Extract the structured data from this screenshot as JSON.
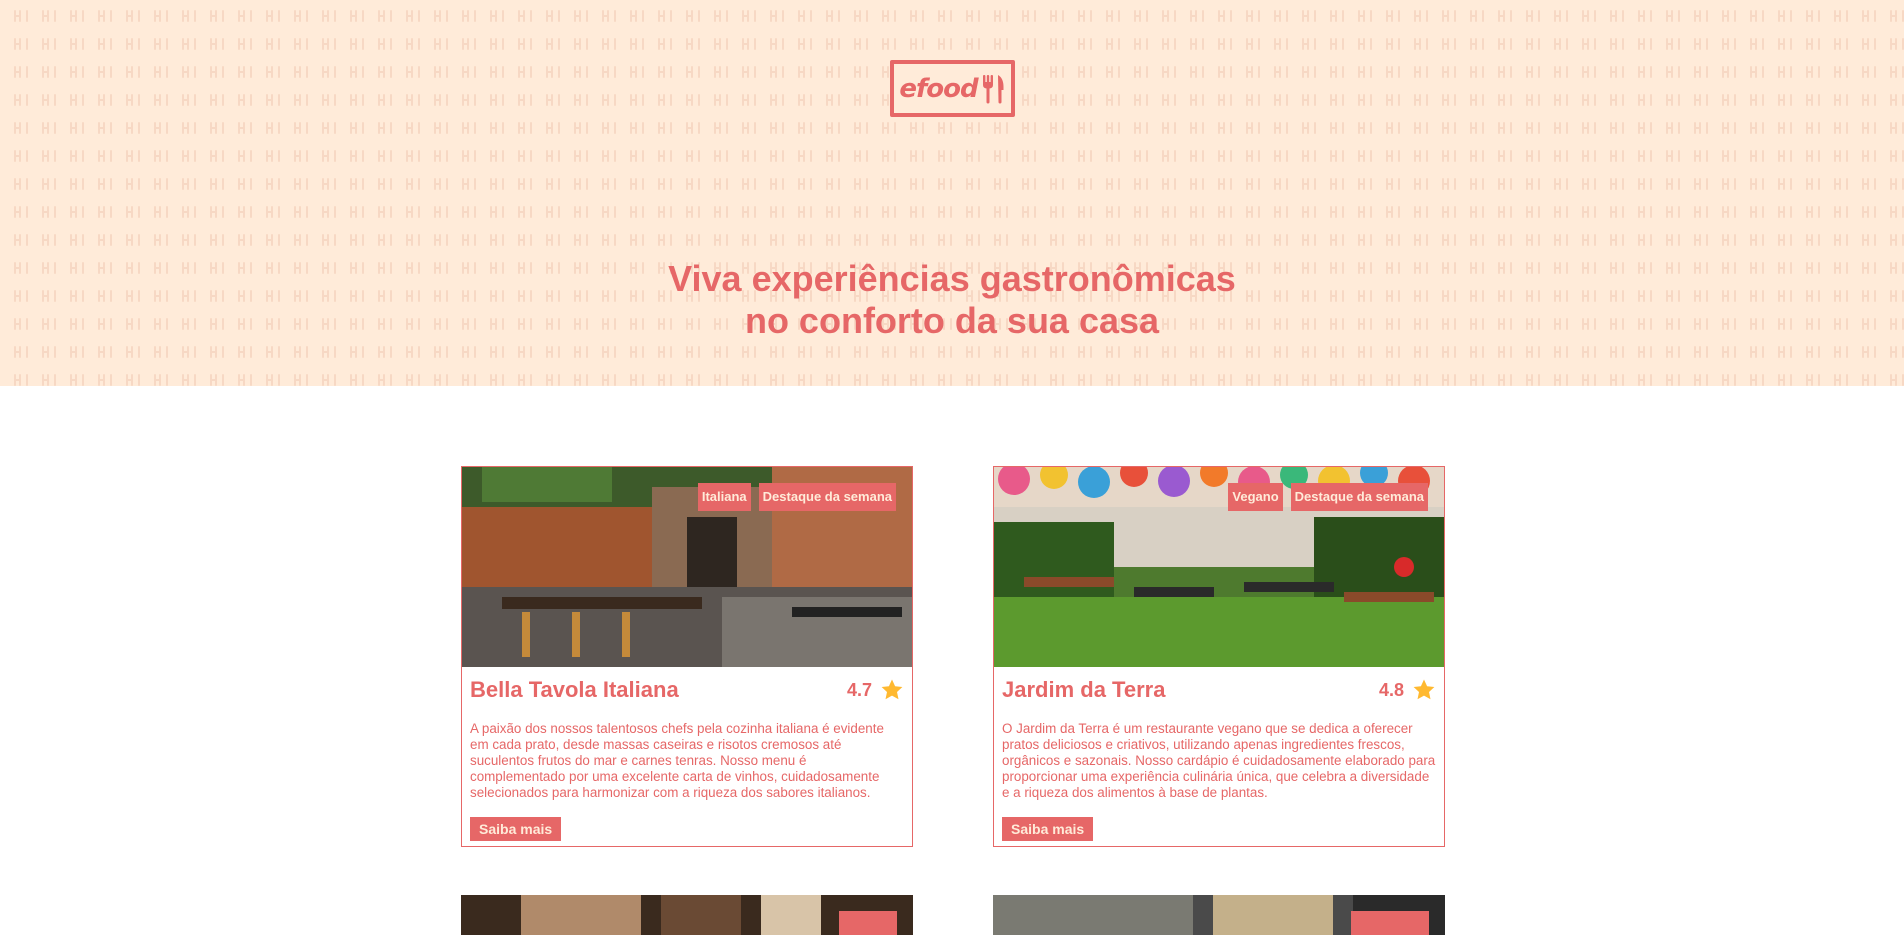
{
  "header": {
    "logo_text": "efood",
    "logo_icon": "fork-knife-icon",
    "pattern_icon": "fork-knife-icon",
    "title_line1": "Viva experiências gastronômicas",
    "title_line2": "no conforto da sua casa"
  },
  "colors": {
    "primary": "#e66767",
    "background_light": "#ffebd9",
    "white": "#ffffff",
    "star": "#ffb930"
  },
  "restaurants": [
    {
      "name": "Bella Tavola Italiana",
      "rating": "4.7",
      "tags": [
        "Italiana",
        "Destaque da semana"
      ],
      "description": "A paixão dos nossos talentosos chefs pela cozinha italiana é evidente em cada prato, desde massas caseiras e risotos cremosos até suculentos frutos do mar e carnes tenras. Nosso menu é complementado por uma excelente carta de vinhos, cuidadosamente selecionados para harmonizar com a riqueza dos sabores italianos.",
      "button_label": "Saiba mais"
    },
    {
      "name": "Jardim da Terra",
      "rating": "4.8",
      "tags": [
        "Vegano",
        "Destaque da semana"
      ],
      "description": "O Jardim da Terra é um restaurante vegano que se dedica a oferecer pratos deliciosos e criativos, utilizando apenas ingredientes frescos, orgânicos e sazonais. Nosso cardápio é cuidadosamente elaborado para proporcionar uma experiência culinária única, que celebra a diversidade e a riqueza dos alimentos à base de plantas.",
      "button_label": "Saiba mais"
    }
  ]
}
